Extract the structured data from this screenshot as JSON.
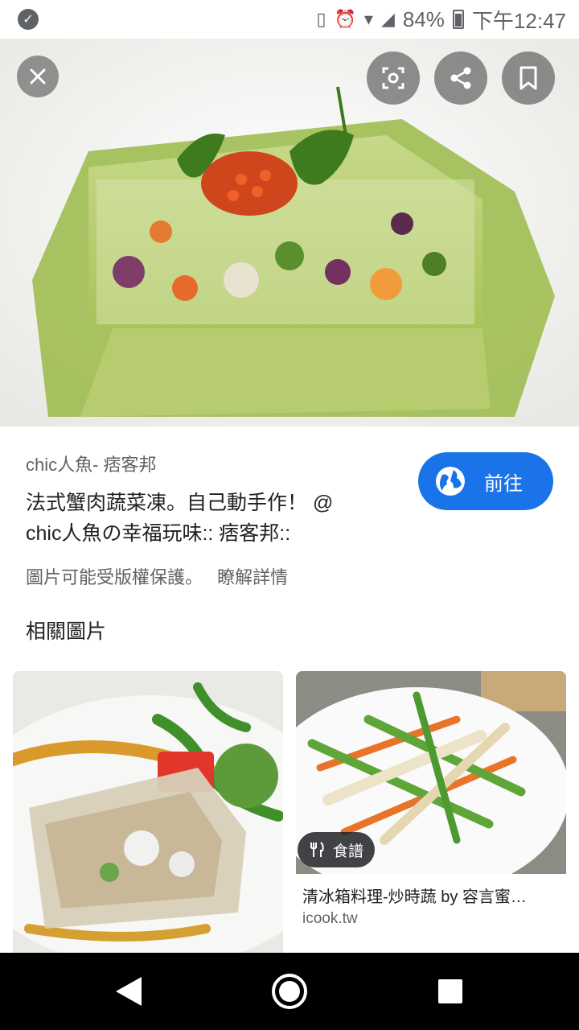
{
  "status_bar": {
    "battery": "84%",
    "time": "下午12:47"
  },
  "hero": {
    "close_icon": "close-icon",
    "lens_icon": "google-lens-icon",
    "share_icon": "share-icon",
    "bookmark_icon": "bookmark-icon"
  },
  "result": {
    "source": "chic人魚- 痞客邦",
    "title_line1": "法式蟹肉蔬菜凍。自己動手作！ @",
    "title_line2": "chic人魚の幸福玩味:: 痞客邦::",
    "visit_label": "前往",
    "copyright_notice": "圖片可能受版權保護。",
    "learn_more": "瞭解詳情"
  },
  "related": {
    "heading": "相關圖片",
    "cards": [
      {},
      {
        "chip_label": "食譜",
        "title": "清冰箱料理-炒時蔬 by 容言蜜…",
        "domain": "icook.tw"
      }
    ]
  },
  "colors": {
    "accent": "#1a73e8",
    "text_primary": "#202124",
    "text_secondary": "#5f6368"
  }
}
